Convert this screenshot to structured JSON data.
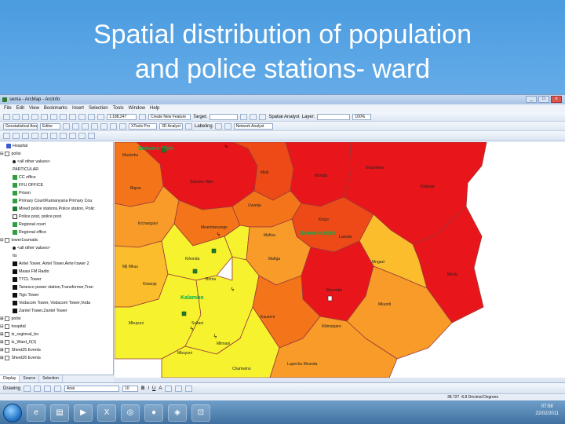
{
  "slide": {
    "title_line1": "Spatial distribution of population",
    "title_line2": "and police stations- ward"
  },
  "window": {
    "title": "sema - ArcMap - ArcInfo",
    "minimize": "_",
    "maximize": "□",
    "close": "x"
  },
  "menu": [
    "File",
    "Edit",
    "View",
    "Bookmarks",
    "Insert",
    "Selection",
    "Tools",
    "Window",
    "Help"
  ],
  "toolbar": {
    "geo_analyst": "Geostatistical Analyst",
    "editor": "Editor",
    "scale": "1:188,247",
    "task": "Create New Feature",
    "target": "Target:",
    "spatial_analyst": "Spatial Analyst",
    "layer": "Layer:",
    "zoom": "100%",
    "georef_layer": "XTools Pro",
    "analyst_3d": "3D Analyst",
    "labeling": "Labeling",
    "network_analyst": "Network Analyst"
  },
  "toc": {
    "items": [
      "Hospital",
      "polisi",
      "<all other values>",
      "PARTICULAR",
      "CC office",
      "FFU OFFICE",
      "Prison",
      "Primary Court/Kamanyana Primary Cou",
      "Mixed police stations,Police station, Polic",
      "Police post, police post",
      "Regional court",
      "Regional office",
      "tower1sumatic",
      "<all other values>",
      "tts",
      "Airtel Tower, Airtel Tower,Airtel tower 2",
      "Maasi FM Radio",
      "TTCL Tower",
      "Tanesco power station,Transformer,Tran",
      "Tigo Tower",
      "Vodacom Tower, Vodacom Tower,Voda",
      "Zantel Tower,Zantel Tower",
      "polisi",
      "hospital",
      "tz_regional_bo",
      "tz_Ward_II(1)",
      "Sheet25 Events",
      "Sheet26 Events"
    ],
    "tabs": [
      "Display",
      "Source",
      "Selection"
    ]
  },
  "map": {
    "labels": {
      "ward1": "Sokoine Mjini",
      "ward2": "Mazimbu",
      "ward3": "Bigwa",
      "ward4": "Mlali",
      "ward5": "Mzinga",
      "ward6": "Kilakala",
      "ward7": "Kichangani",
      "ward8": "Mwembesongo",
      "ward9": "Uwanja",
      "ward10": "Mafisa",
      "ward11": "Kingo",
      "ward12": "Mji Mkuu",
      "ward13": "Kihonda",
      "ward14": "Kiwanja",
      "ward15": "Boma",
      "ward16": "Mafiga",
      "ward17": "Mbuyuni",
      "ward18": "Sultani",
      "ward19": "Kauzeni",
      "ward20": "Mwembe",
      "ward21": "Kilimanjaro",
      "ward22": "Mkundi",
      "ward23": "Mngazi",
      "ward24": "Lukobe",
      "ward25": "Mindu",
      "ward26": "Kingolwira",
      "ward27": "Mlimani",
      "ward28": "Mbuyuni",
      "ward29": "Lupecha Mvanda",
      "ward30": "Chamwino",
      "town1": "Sokoine Mjini",
      "town2": "Sokoine Mjini",
      "town3": "Kalambo"
    },
    "colors": {
      "red": "#e8161b",
      "redorange": "#ee4a17",
      "orange": "#f4741a",
      "lightorange": "#f89b29",
      "amber": "#fbbd2c",
      "yellow": "#f6f22e",
      "boundary": "#9a3a3a",
      "town": "#00b050"
    }
  },
  "drawing": {
    "label": "Drawing",
    "font": "Arial",
    "size": "10",
    "bold": "B",
    "italic": "I",
    "underline": "U",
    "text": "A"
  },
  "status": {
    "coords": "38.727  -6.8 Decimal Degrees"
  },
  "taskbar": {
    "time": "07:58",
    "date": "22/02/2011"
  }
}
